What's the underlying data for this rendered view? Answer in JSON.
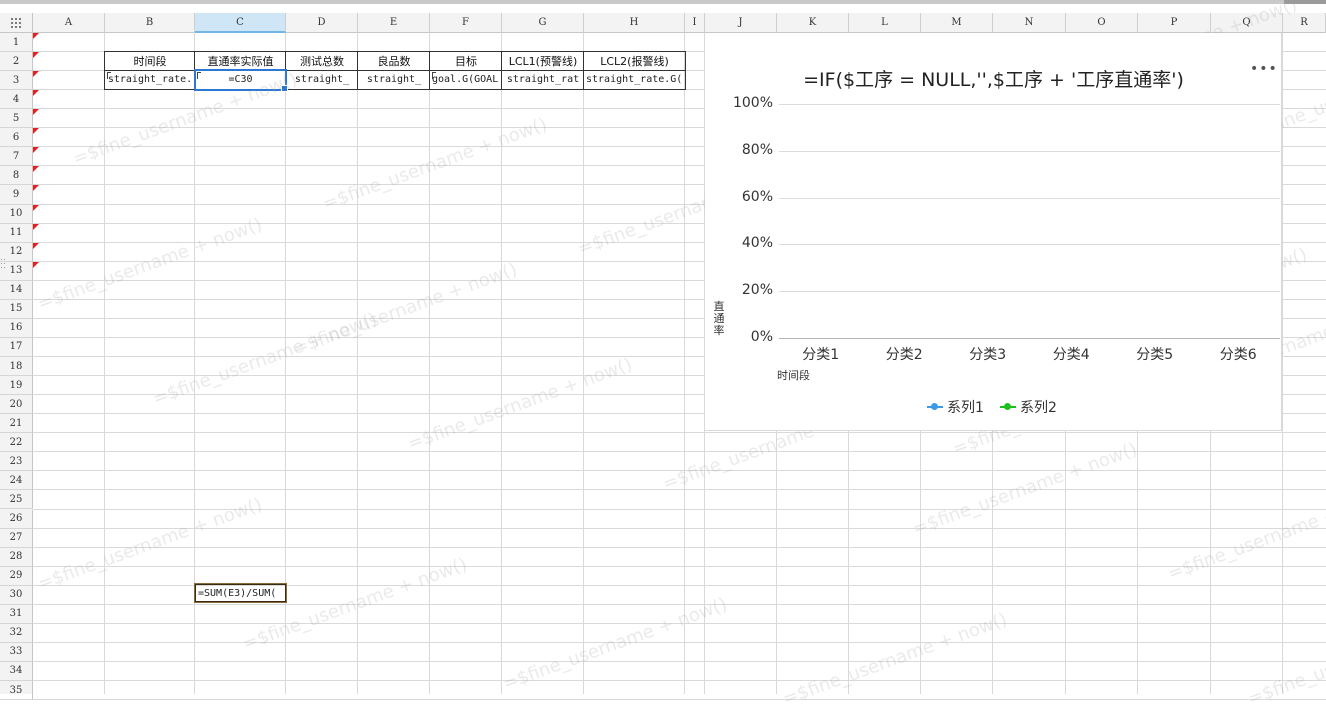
{
  "columns": [
    "A",
    "B",
    "C",
    "D",
    "E",
    "F",
    "G",
    "H",
    "I",
    "J",
    "K",
    "L",
    "M",
    "N",
    "O",
    "P",
    "Q",
    "R"
  ],
  "rows": [
    "1",
    "2",
    "3",
    "4",
    "5",
    "6",
    "7",
    "8",
    "9",
    "10",
    "11",
    "12",
    "13",
    "14",
    "15",
    "16",
    "17",
    "18",
    "19",
    "20",
    "21",
    "22",
    "23",
    "24",
    "25",
    "26",
    "27",
    "28",
    "29",
    "30",
    "31",
    "32",
    "33",
    "34",
    "35"
  ],
  "selected_column": "C",
  "table": {
    "headers": [
      "时间段",
      "直通率实际值",
      "测试总数",
      "良品数",
      "目标",
      "LCL1(预警线)",
      "LCL2(报警线)"
    ],
    "row3": [
      "straight_rate.",
      "=C30",
      "straight_",
      "straight_",
      "goal.G(GOAL",
      "straight_rat",
      "straight_rate.G("
    ]
  },
  "cell_c30": "=SUM(E3)/SUM(",
  "watermark": "=$fine_username + now()",
  "chart": {
    "menu_icon": "more-icon",
    "legend_colors": [
      "#3a9ae8",
      "#1cc01c"
    ]
  },
  "chart_data": {
    "type": "line",
    "title": "=IF($工序 = NULL,'',$工序 + '工序直通率')",
    "categories": [
      "分类1",
      "分类2",
      "分类3",
      "分类4",
      "分类5",
      "分类6"
    ],
    "yticks": [
      "100%",
      "80%",
      "60%",
      "40%",
      "20%",
      "0%"
    ],
    "ylim": [
      0,
      100
    ],
    "xlabel": "时间段",
    "ylabel": "直通率",
    "grid": true,
    "legend_position": "bottom",
    "series": [
      {
        "name": "系列1",
        "values": []
      },
      {
        "name": "系列2",
        "values": []
      }
    ]
  }
}
